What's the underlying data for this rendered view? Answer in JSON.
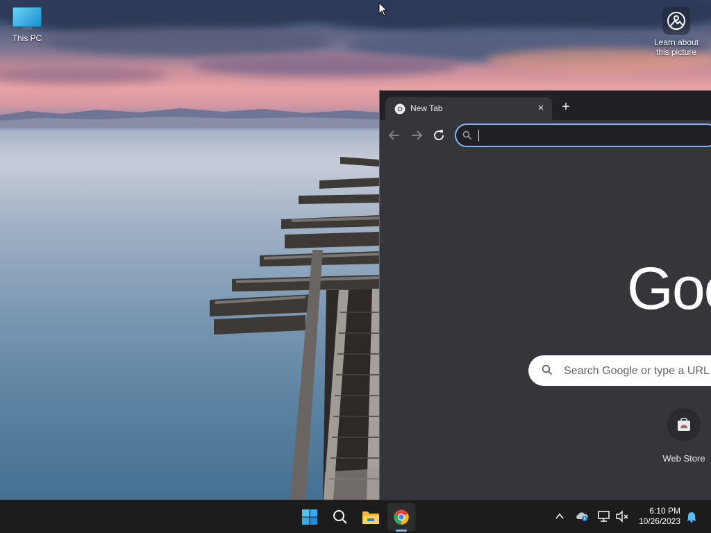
{
  "desktop": {
    "icons": [
      {
        "label": "This PC",
        "icon": "computer-icon"
      },
      {
        "label": "Learn about this picture",
        "icon": "camera-icon"
      }
    ]
  },
  "browser": {
    "tab": {
      "title": "New Tab",
      "favicon": "chrome-icon"
    },
    "new_tab_symbol": "+",
    "close_symbol": "×",
    "omnibox": {
      "value": "",
      "placeholder": ""
    },
    "ntp": {
      "logo_text": "Google",
      "search_placeholder": "Search Google or type a URL",
      "shortcuts": [
        {
          "label": "Web Store",
          "icon": "web-store-icon"
        }
      ]
    },
    "colors": {
      "frame": "#202124",
      "surface": "#35363a",
      "focus_ring": "#8ab4f8"
    }
  },
  "taskbar": {
    "apps": [
      {
        "name": "Start",
        "icon": "windows-start-icon"
      },
      {
        "name": "Search",
        "icon": "search-icon"
      },
      {
        "name": "File Explorer",
        "icon": "folder-icon"
      },
      {
        "name": "Google Chrome",
        "icon": "chrome-icon",
        "active": true
      }
    ],
    "tray": {
      "time": "6:10 PM",
      "date": "10/26/2023",
      "icons": [
        "chevron-up-icon",
        "onedrive-icon",
        "network-icon",
        "volume-muted-icon",
        "notification-bell-icon"
      ]
    }
  }
}
